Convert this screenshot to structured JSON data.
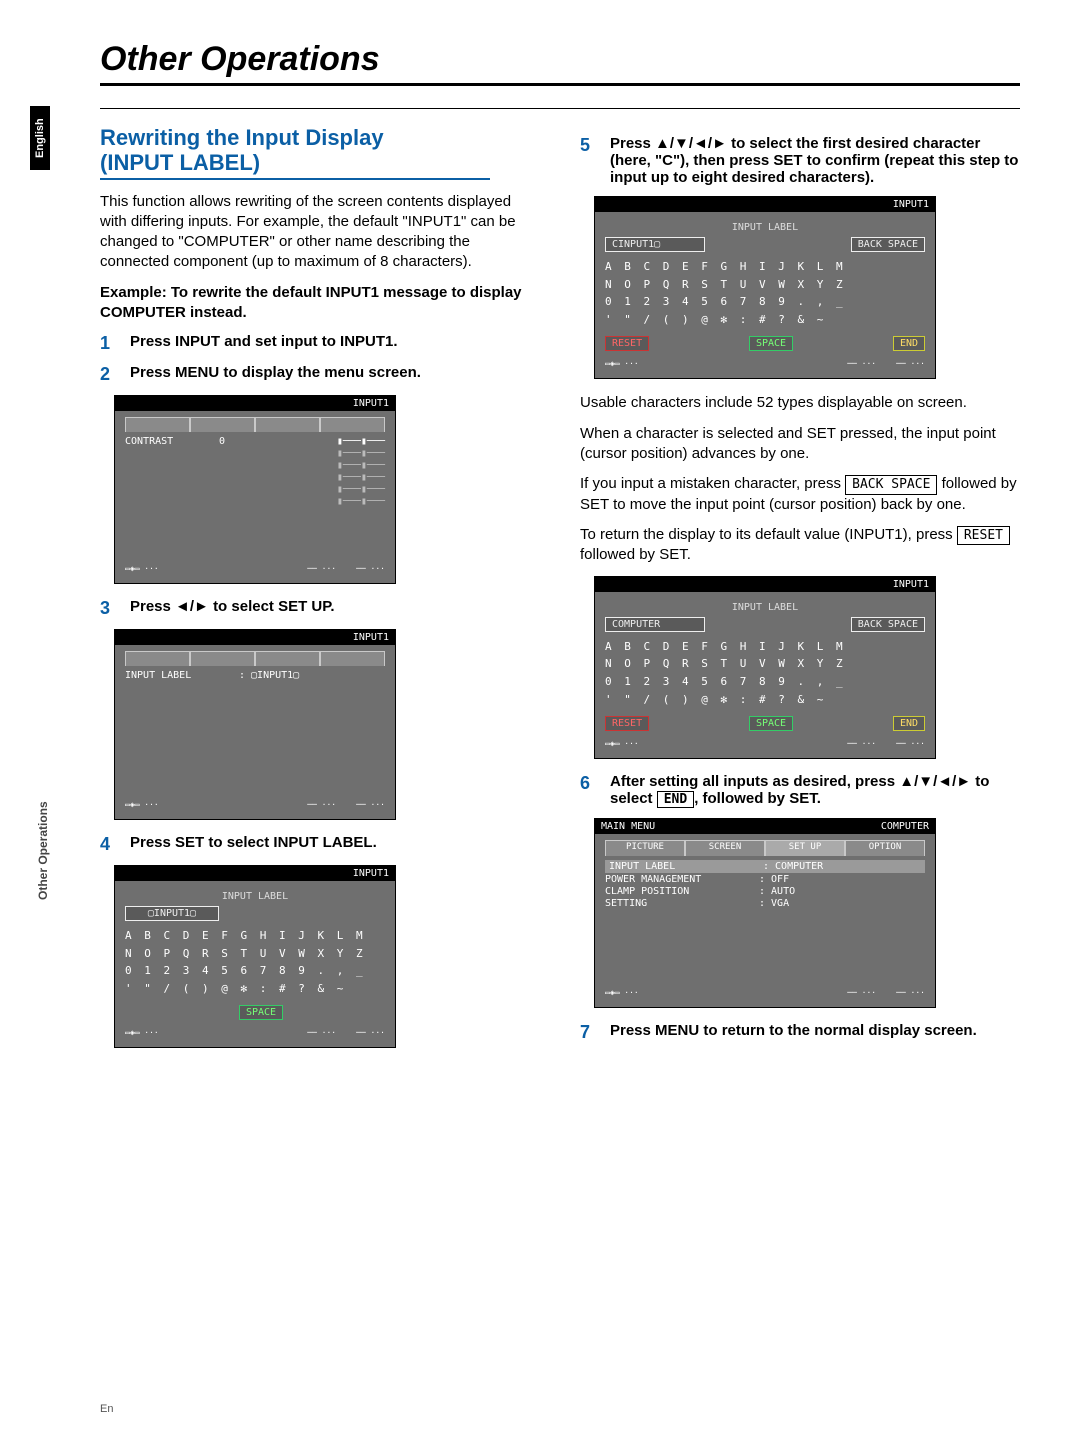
{
  "lang_tab": "English",
  "side_caption": "Other Operations",
  "page_number": "En",
  "title": "Other Operations",
  "subtitle_line1": "Rewriting the Input Display",
  "subtitle_line2": "(INPUT LABEL)",
  "intro": "This function allows rewriting of the screen contents displayed with differing inputs. For example, the default \"INPUT1\" can be changed to \"COMPUTER\" or other name describing the connected component (up to maximum of 8 characters).",
  "example_lead": "Example: To rewrite the default INPUT1 message to display COMPUTER instead.",
  "step1_num": "1",
  "step1_txt": "Press INPUT and set input to INPUT1.",
  "step2_num": "2",
  "step2_txt": "Press MENU to display the menu screen.",
  "step3_num": "3",
  "step3_txt": "Press ◄/► to select SET UP.",
  "step4_num": "4",
  "step4_txt": "Press SET to select INPUT LABEL.",
  "step5_num": "5",
  "step5_txt": "Press ▲/▼/◄/► to select the first desired character (here, \"C\"), then press SET to confirm (repeat this step to input up to eight desired characters).",
  "step6_num": "6",
  "step6_txt_a": "After setting all inputs as desired, press ▲/▼/◄/► to select ",
  "step6_box": "END",
  "step6_txt_b": ", followed by SET.",
  "step7_num": "7",
  "step7_txt": "Press MENU to return to the normal display screen.",
  "notes_a": "Usable characters include 52 types displayable on screen.",
  "notes_b": "When a character is selected and SET pressed, the input point (cursor position) advances by one.",
  "notes_c_a": "If you input a mistaken character, press ",
  "notes_c_box": "BACK SPACE",
  "notes_c_b": " followed by SET to move the input point (cursor position) back by one.",
  "notes_d_a": "To return the display to its default value (INPUT1), press ",
  "notes_d_box": "RESET",
  "notes_d_b": " followed by SET.",
  "osd_input_hdr": "INPUT1",
  "osd_mainmenu_title": "MAIN MENU",
  "osd_mainmenu_hdr_right": "COMPUTER",
  "osd_tabs": [
    "PICTURE",
    "SCREEN",
    "SET UP",
    "OPTION"
  ],
  "osd_setup_items": {
    "input_label": "INPUT LABEL",
    "input_label_val": ": COMPUTER",
    "pm": "POWER MANAGEMENT",
    "pm_val": ": OFF",
    "clamp": "CLAMP POSITION",
    "clamp_val": ": AUTO",
    "setting": "SETTING",
    "setting_val": ": VGA"
  },
  "osd_setup_items2": {
    "input_label": "INPUT LABEL",
    "input_label_val": ": ▢INPUT1▢"
  },
  "osd_picture_row": {
    "key": "CONTRAST",
    "val": "0"
  },
  "osd_label_screen": {
    "heading": "INPUT LABEL",
    "field1": "CINPUT1▢",
    "field2": "COMPUTER",
    "backspace": "BACK SPACE",
    "reset": "RESET",
    "space": "SPACE",
    "end": "END",
    "charset_row1": "A B C D E F G H I J K L M",
    "charset_row2": "N O P Q R S T U V W X Y Z",
    "charset_row3": "0 1 2 3 4 5 6 7 8 9 . , _",
    "charset_row4": "' \" / ( ) @ ✻ : # ? & ~"
  },
  "osd_label_screen_step4_field": "▢INPUT1▢"
}
